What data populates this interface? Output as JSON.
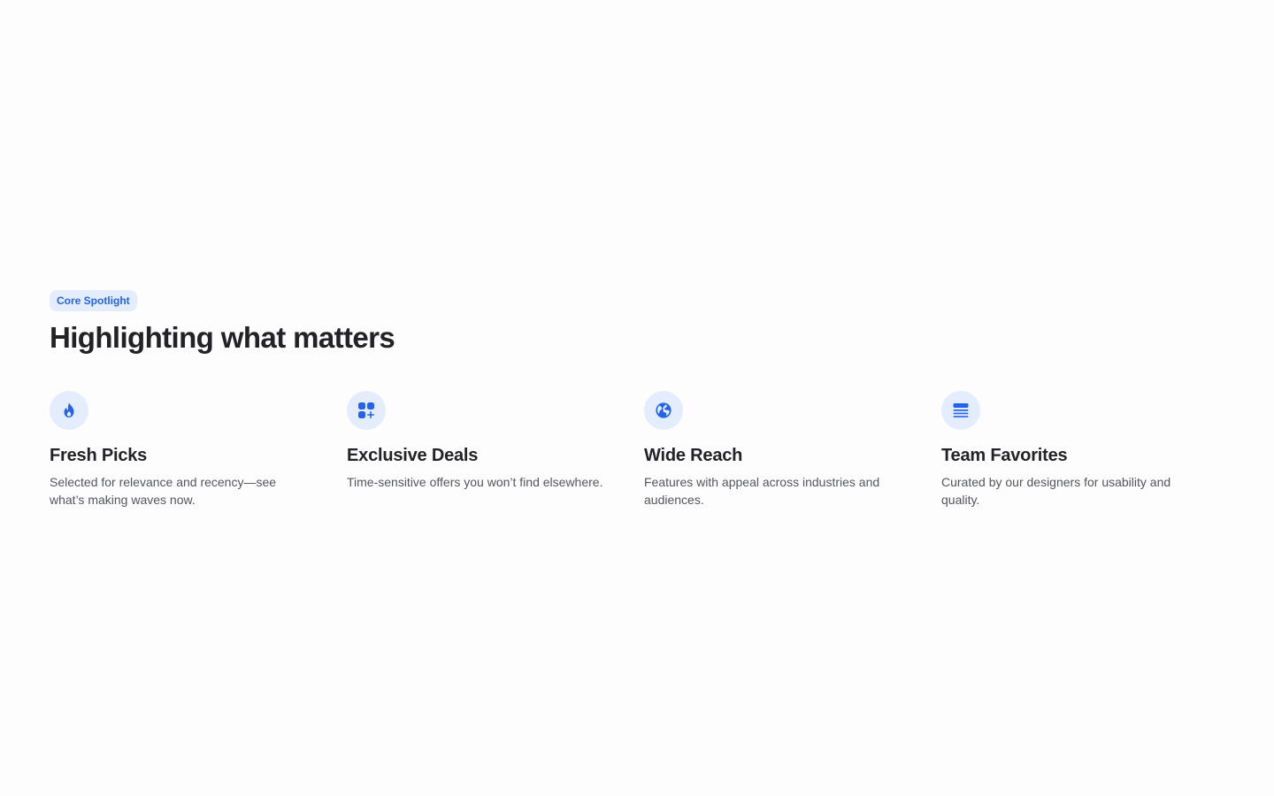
{
  "section": {
    "badge": "Core Spotlight",
    "title": "Highlighting what matters"
  },
  "colors": {
    "accent": "#2563eb",
    "icon_background": "#e3edfd",
    "heading": "#232327",
    "body_text": "#55565c",
    "page_background": "#fdfdfe"
  },
  "features": [
    {
      "icon": "flame-icon",
      "title": "Fresh Picks",
      "description": "Selected for relevance and recency—see what’s making waves now."
    },
    {
      "icon": "apps-add-icon",
      "title": "Exclusive Deals",
      "description": "Time-sensitive offers you won’t find elsewhere."
    },
    {
      "icon": "globe-icon",
      "title": "Wide Reach",
      "description": "Features with appeal across industries and audiences."
    },
    {
      "icon": "stack-icon",
      "title": "Team Favorites",
      "description": "Curated by our designers for usability and quality."
    }
  ]
}
